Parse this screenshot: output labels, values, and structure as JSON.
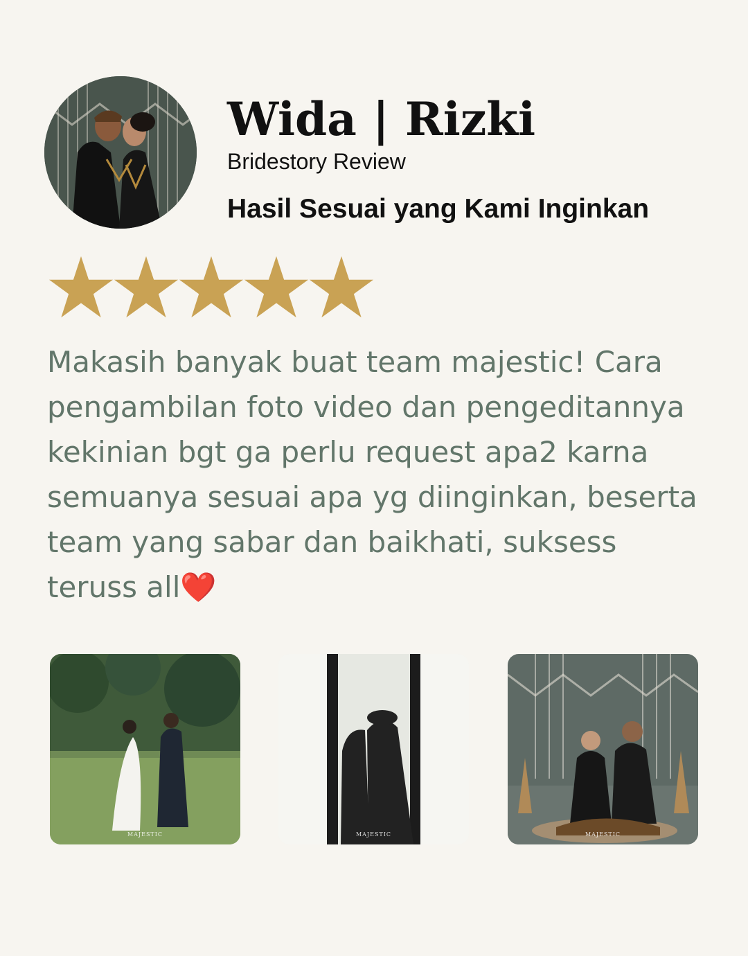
{
  "profile": {
    "name": "Wida | Rizki",
    "source": "Bridestory Review",
    "headline": "Hasil Sesuai yang Kami Inginkan"
  },
  "rating": {
    "value": 5,
    "max": 5,
    "star_color": "#c9a254"
  },
  "review": {
    "text": "Makasih banyak buat team majestic! Cara pengambilan foto video dan pengeditannya kekinian bgt ga perlu request apa2 karna semuanya sesuai apa yg diinginkan, beserta team yang sabar dan baikhati, suksess teruss all",
    "emoji": "❤️"
  },
  "gallery": {
    "watermark": "MAJESTIC"
  },
  "colors": {
    "background": "#f7f5f0",
    "review_text": "#62766a",
    "heading_text": "#111111"
  }
}
